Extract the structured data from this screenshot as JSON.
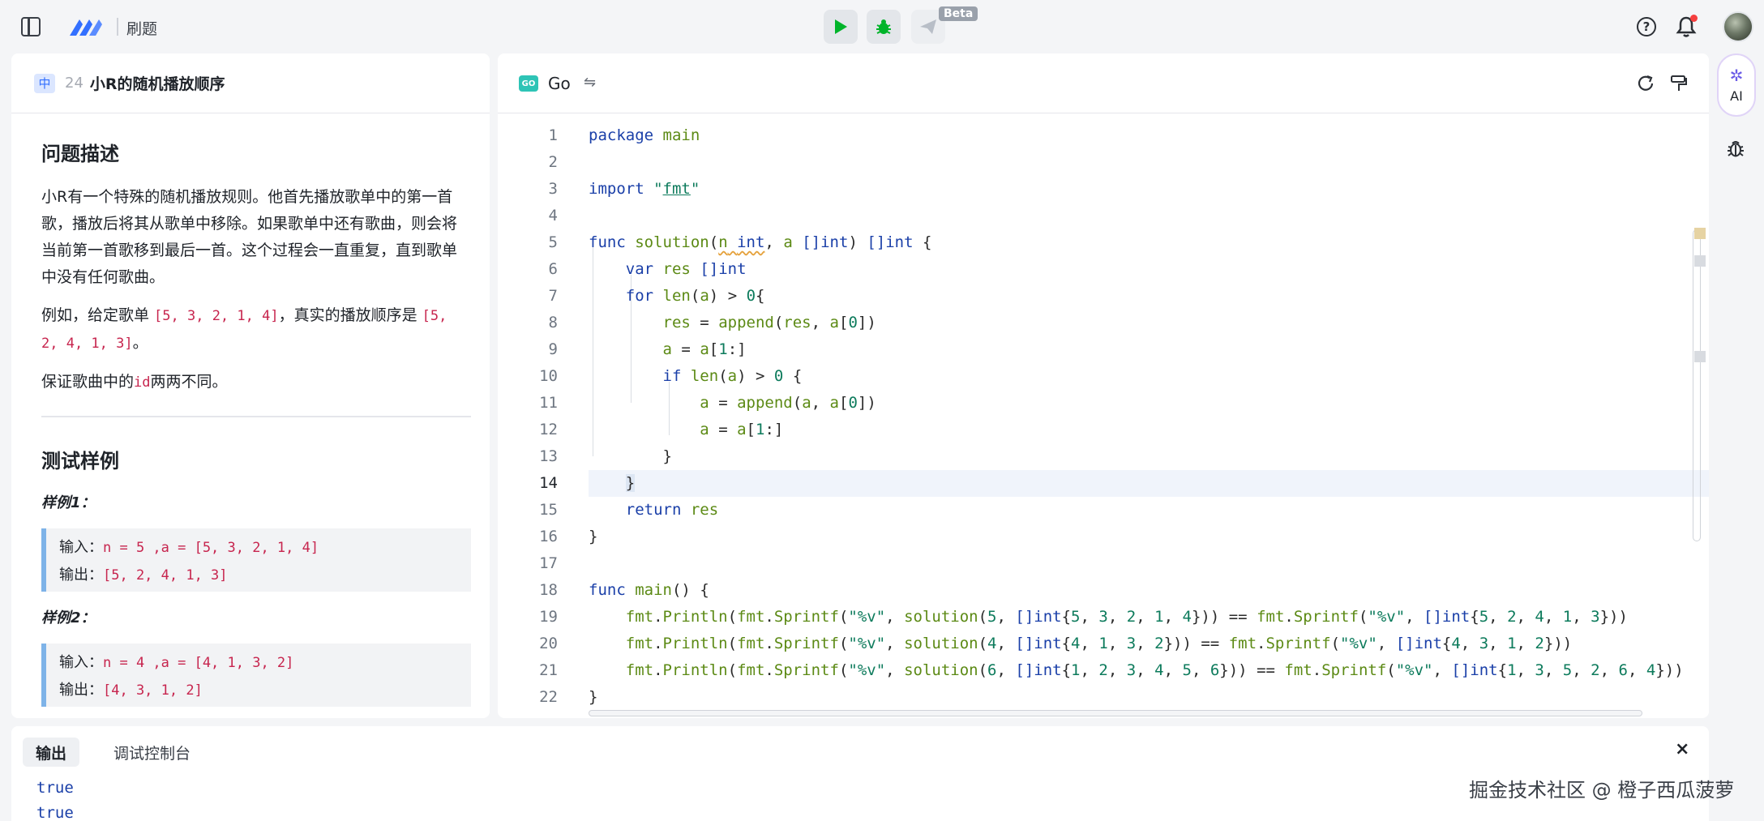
{
  "topbar": {
    "title": "刷题",
    "beta": "Beta",
    "icons": [
      "sidebar-toggle-icon",
      "logo",
      "play-icon",
      "bug-icon",
      "send-icon",
      "help-icon",
      "bell-icon",
      "avatar"
    ]
  },
  "problem": {
    "difficulty": "中",
    "number": "24",
    "title": "小R的随机播放顺序",
    "section_description": "问题描述",
    "desc_1": "小R有一个特殊的随机播放规则。他首先播放歌单中的第一首歌，播放后将其从歌单中移除。如果歌单中还有歌曲，则会将当前第一首歌移到最后一首。这个过程会一直重复，直到歌单中没有任何歌曲。",
    "desc_2_prefix": "例如，给定歌单 ",
    "desc_2_code1": "[5, 3, 2, 1, 4]",
    "desc_2_mid": "，真实的播放顺序是 ",
    "desc_2_code2": "[5, 2, 4, 1, 3]",
    "desc_2_suffix": "。",
    "desc_3_prefix": "保证歌曲中的",
    "desc_3_code": "id",
    "desc_3_suffix": "两两不同。",
    "section_tests": "测试样例",
    "examples": [
      {
        "label": "样例1：",
        "input_label": "输入：",
        "input": "n = 5 ,a = [5, 3, 2, 1, 4]",
        "output_label": "输出：",
        "output": "[5, 2, 4, 1, 3]"
      },
      {
        "label": "样例2：",
        "input_label": "输入：",
        "input": "n = 4 ,a = [4, 1, 3, 2]",
        "output_label": "输出：",
        "output": "[4, 3, 1, 2]"
      }
    ]
  },
  "editor": {
    "language": "Go",
    "swap_symbol": "⇋",
    "active_line": 14,
    "line_numbers": [
      "1",
      "2",
      "3",
      "4",
      "5",
      "6",
      "7",
      "8",
      "9",
      "10",
      "11",
      "12",
      "13",
      "14",
      "15",
      "16",
      "17",
      "18",
      "19",
      "20",
      "21",
      "22"
    ]
  },
  "ai": {
    "label": "AI",
    "spark": "✲"
  },
  "output": {
    "tab_output": "输出",
    "tab_console": "调试控制台",
    "close": "×",
    "lines": [
      "true",
      "true"
    ]
  },
  "watermark": "掘金技术社区 @ 橙子西瓜菠萝",
  "colors": {
    "accent": "#3370ff",
    "run_green": "#00b42a",
    "keyword": "#1a3fa8",
    "func": "#5c8a15",
    "string": "#0d7b5c"
  }
}
